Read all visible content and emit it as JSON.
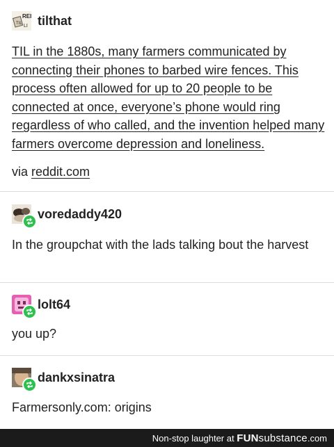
{
  "posts": [
    {
      "username": "tilthat",
      "body": "TIL in the 1880s, many farmers communicated by connecting their phones to barbed wire fences. This process often allowed for up to 20 people to be connected at once, everyone’s phone would ring regardless of who called, and the invention helped many farmers overcome depression and loneliness.",
      "via_prefix": "via ",
      "via_link": "reddit.com",
      "avatar_text": "REI TIL"
    },
    {
      "username": "voredaddy420",
      "body": "In the groupchat with the lads talking bout the harvest"
    },
    {
      "username": "lolt64",
      "body": "you up?"
    },
    {
      "username": "dankxsinatra",
      "body": "Farmersonly.com: origins"
    }
  ],
  "footer": {
    "text": "Non-stop laughter at ",
    "brand_bold": "FUN",
    "brand_thin": "substance",
    "brand_suffix": ".com"
  },
  "colors": {
    "reblog_badge": "#2ec04f",
    "footer_bg": "#1b1b1b",
    "divider": "#dcdcdc"
  },
  "icons": {
    "reblog": "reblog-icon"
  }
}
